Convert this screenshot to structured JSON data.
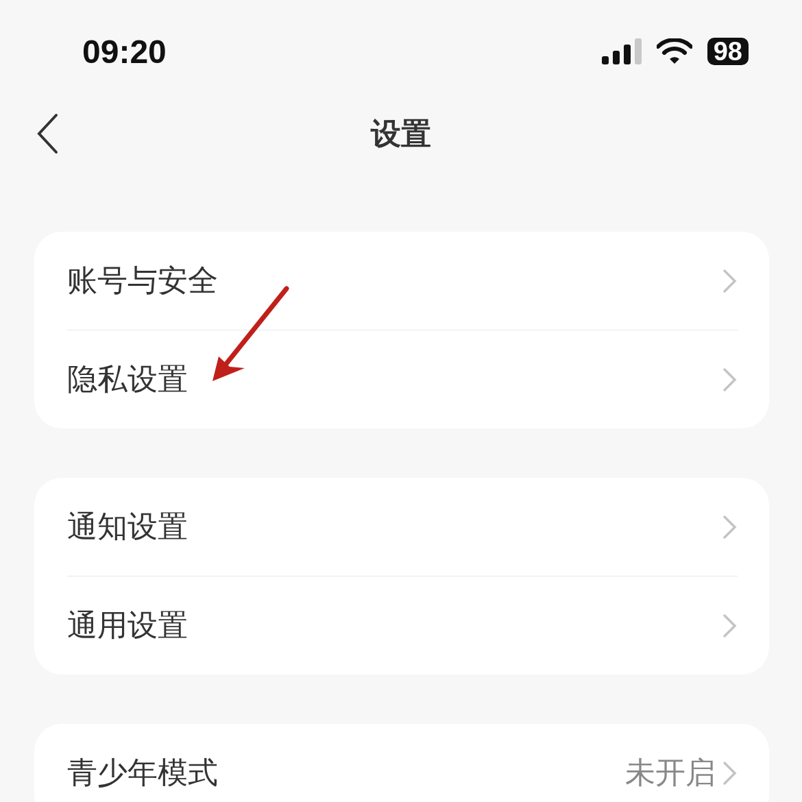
{
  "status_bar": {
    "time": "09:20",
    "battery": "98"
  },
  "header": {
    "title": "设置"
  },
  "groups": [
    {
      "items": [
        {
          "label": "账号与安全"
        },
        {
          "label": "隐私设置"
        }
      ]
    },
    {
      "items": [
        {
          "label": "通知设置"
        },
        {
          "label": "通用设置"
        }
      ]
    },
    {
      "items": [
        {
          "label": "青少年模式",
          "value": "未开启"
        }
      ]
    }
  ]
}
